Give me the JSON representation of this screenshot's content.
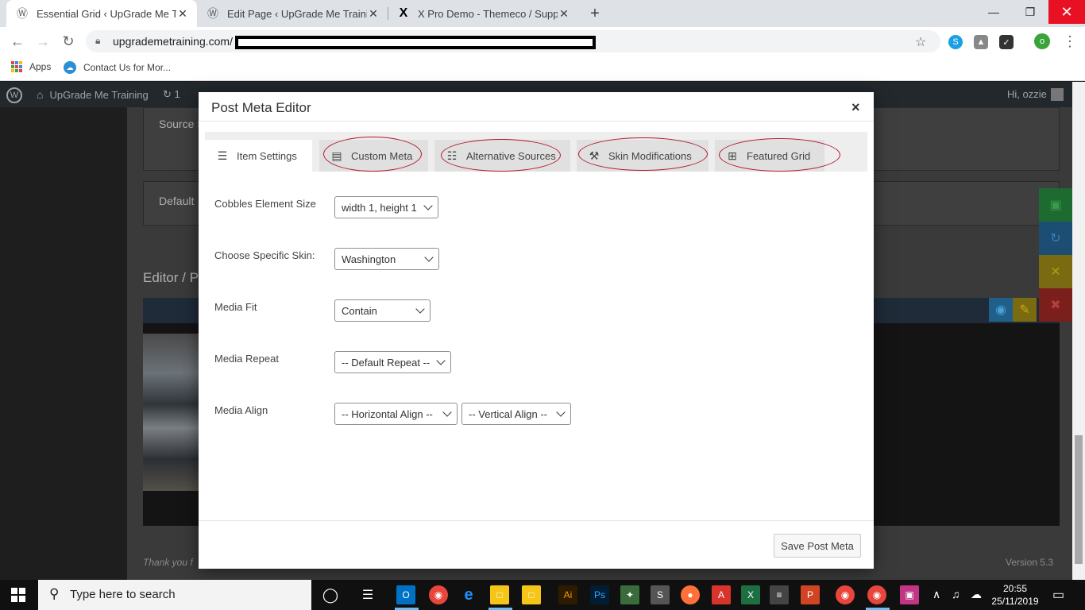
{
  "browser": {
    "tabs": [
      {
        "title": "Essential Grid ‹ UpGrade Me Trai",
        "favicon": "wordpress-icon",
        "active": true
      },
      {
        "title": "Edit Page ‹ UpGrade Me Training",
        "favicon": "wordpress-icon",
        "active": false
      },
      {
        "title": "X Pro Demo - Themeco / Suppor",
        "favicon": "x-logo-icon",
        "active": false
      }
    ],
    "new_tab": "+",
    "url": "upgrademetraining.com/",
    "bookmarks": [
      {
        "label": "Apps",
        "icon": "apps-grid-icon"
      },
      {
        "label": "Contact Us for Mor...",
        "icon": "support-icon"
      }
    ],
    "profile_initial": "o"
  },
  "wp_admin_bar": {
    "site_name": "UpGrade Me Training",
    "updates": "1",
    "greeting": "Hi, ozzie"
  },
  "background": {
    "source_label": "Source S",
    "default_label": "Default",
    "editor_label": "Editor / P",
    "thank_you": "Thank you f",
    "version": "Version 5.3"
  },
  "modal": {
    "title": "Post Meta Editor",
    "close": "×",
    "tabs": [
      {
        "label": "Item Settings",
        "icon": "item-settings-icon",
        "active": true
      },
      {
        "label": "Custom Meta",
        "icon": "custom-meta-icon",
        "active": false
      },
      {
        "label": "Alternative Sources",
        "icon": "alternative-sources-icon",
        "active": false
      },
      {
        "label": "Skin Modifications",
        "icon": "skin-modifications-icon",
        "active": false
      },
      {
        "label": "Featured Grid",
        "icon": "featured-grid-icon",
        "active": false
      }
    ],
    "fields": [
      {
        "label": "Cobbles Element Size",
        "values": [
          "width 1, height 1"
        ]
      },
      {
        "label": "Choose Specific Skin:",
        "values": [
          "Washington"
        ]
      },
      {
        "label": "Media Fit",
        "values": [
          "Contain"
        ]
      },
      {
        "label": "Media Repeat",
        "values": [
          "-- Default Repeat --"
        ]
      },
      {
        "label": "Media Align",
        "values": [
          "-- Horizontal Align --",
          "-- Vertical Align --"
        ]
      }
    ],
    "save_label": "Save Post Meta"
  },
  "taskbar": {
    "search_placeholder": "Type here to search",
    "time": "20:55",
    "date": "25/11/2019"
  },
  "colors": {
    "annotation_circle": "#b2182b",
    "wp_admin_bar": "#23282d",
    "close_button_red": "#e81123"
  }
}
